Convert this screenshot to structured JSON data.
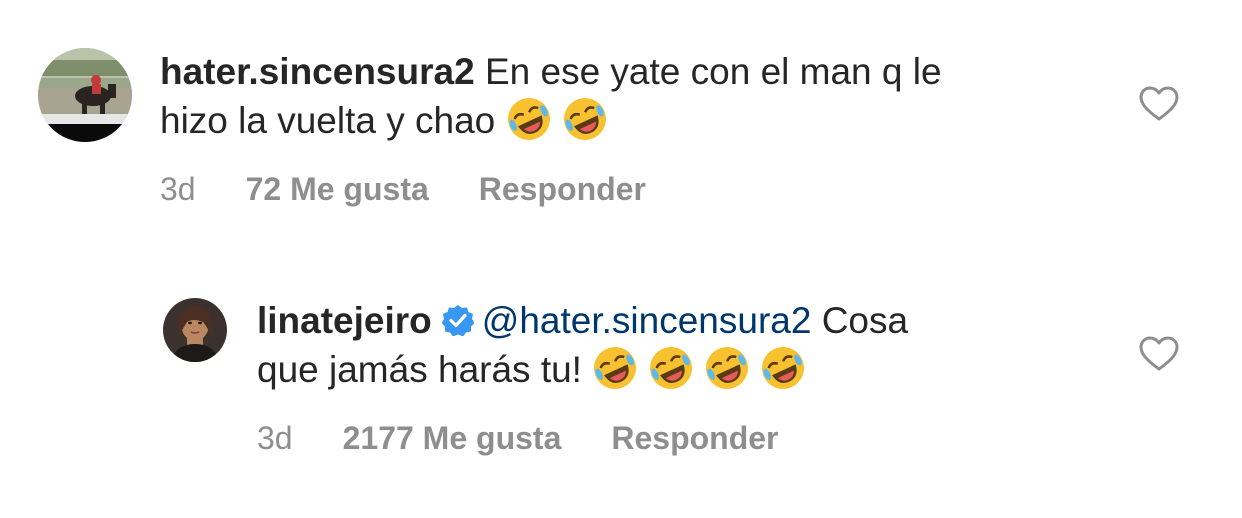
{
  "comments": [
    {
      "username": "hater.sincensura2",
      "mention": "",
      "text_line1": "En ese yate con el man q le",
      "text_line2": "hizo la vuelta y chao",
      "emoji_count": 2,
      "time": "3d",
      "likes": "72 Me gusta",
      "reply": "Responder",
      "verified": false
    },
    {
      "username": "linatejeiro",
      "mention": "@hater.sincensura2",
      "text_line1": "Cosa",
      "text_line2": "que jamás harás tu!",
      "emoji_count": 4,
      "time": "3d",
      "likes": "2177 Me gusta",
      "reply": "Responder",
      "verified": true
    }
  ],
  "icons": {
    "like": "heart-outline-icon",
    "emoji": "rolling-on-floor-laughing-emoji",
    "verified": "verified-badge-icon"
  },
  "colors": {
    "text": "#262626",
    "meta": "#8e8e8e",
    "mention": "#00376b",
    "verified": "#3897f0",
    "emoji": "#f7c12f"
  }
}
